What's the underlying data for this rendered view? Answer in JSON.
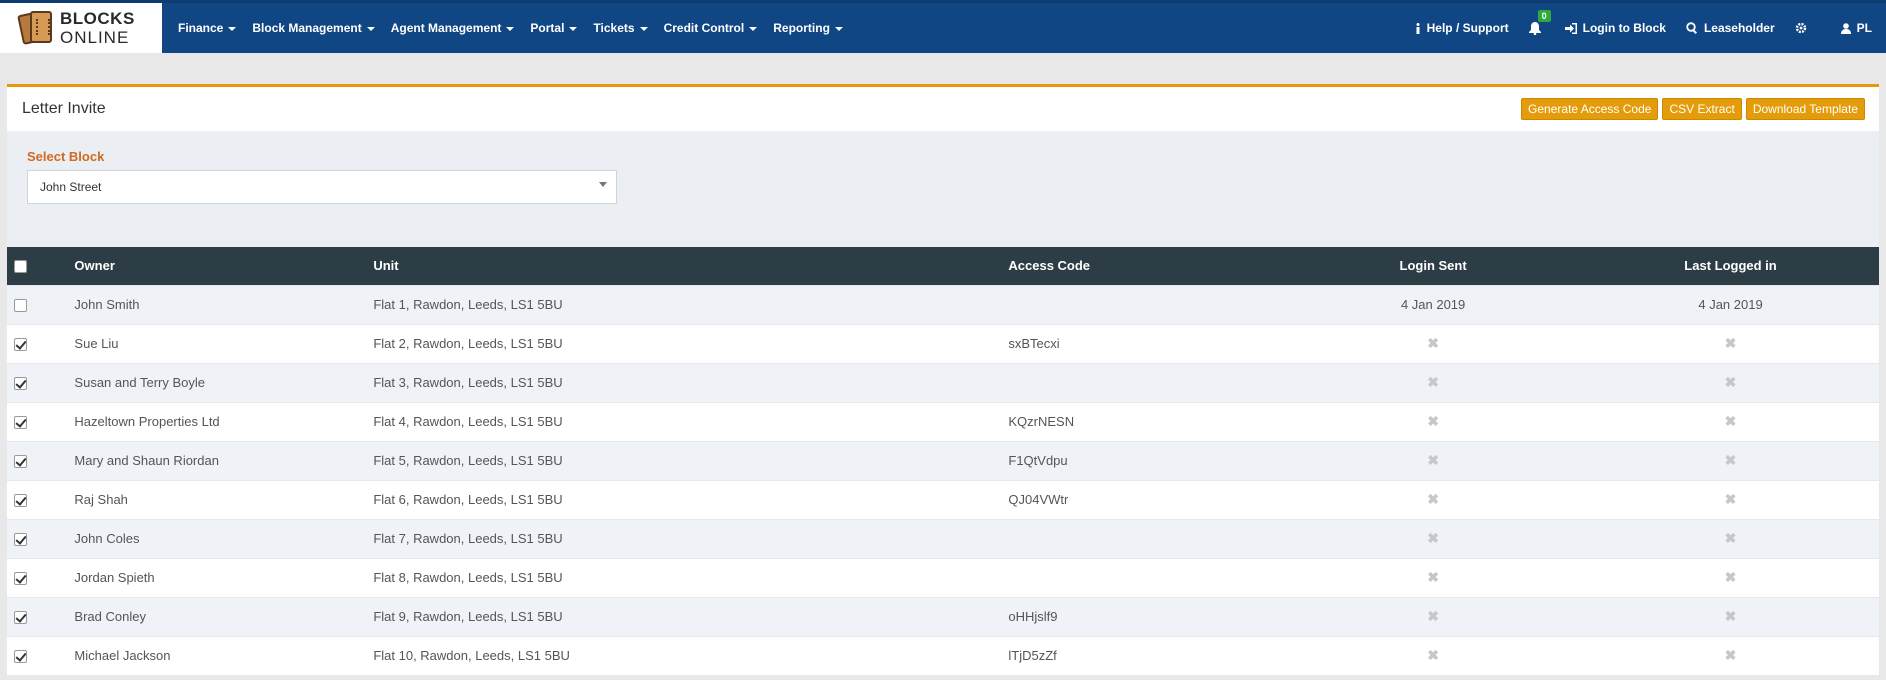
{
  "brand": {
    "line1": "BLOCKS",
    "line2": "ONLINE"
  },
  "nav": {
    "menu": [
      {
        "label": "Finance"
      },
      {
        "label": "Block Management"
      },
      {
        "label": "Agent Management"
      },
      {
        "label": "Portal"
      },
      {
        "label": "Tickets"
      },
      {
        "label": "Credit Control"
      },
      {
        "label": "Reporting"
      }
    ],
    "help": "Help / Support",
    "notifications_count": "0",
    "login_to_block": "Login to Block",
    "leaseholder": "Leaseholder",
    "user_initials": "PL"
  },
  "panel": {
    "title": "Letter Invite",
    "buttons": {
      "generate": "Generate Access Code",
      "csv": "CSV Extract",
      "download": "Download Template"
    },
    "select_block_label": "Select Block",
    "select_block_value": "John Street"
  },
  "table": {
    "headers": {
      "owner": "Owner",
      "unit": "Unit",
      "access_code": "Access Code",
      "login_sent": "Login Sent",
      "last_logged_in": "Last Logged in"
    },
    "rows": [
      {
        "checked": false,
        "owner": "John Smith",
        "unit": "Flat 1, Rawdon, Leeds, LS1 5BU",
        "access_code": "",
        "login_sent": "4 Jan 2019",
        "last_logged_in": "4 Jan 2019"
      },
      {
        "checked": true,
        "owner": "Sue Liu",
        "unit": "Flat 2, Rawdon, Leeds, LS1 5BU",
        "access_code": "sxBTecxi",
        "login_sent": "✖",
        "last_logged_in": "✖"
      },
      {
        "checked": true,
        "owner": "Susan and Terry Boyle",
        "unit": "Flat 3, Rawdon, Leeds, LS1 5BU",
        "access_code": "",
        "login_sent": "✖",
        "last_logged_in": "✖"
      },
      {
        "checked": true,
        "owner": "Hazeltown Properties Ltd",
        "unit": "Flat 4, Rawdon, Leeds, LS1 5BU",
        "access_code": "KQzrNESN",
        "login_sent": "✖",
        "last_logged_in": "✖"
      },
      {
        "checked": true,
        "owner": "Mary and Shaun Riordan",
        "unit": "Flat 5, Rawdon, Leeds, LS1 5BU",
        "access_code": "F1QtVdpu",
        "login_sent": "✖",
        "last_logged_in": "✖"
      },
      {
        "checked": true,
        "owner": "Raj Shah",
        "unit": "Flat 6, Rawdon, Leeds, LS1 5BU",
        "access_code": "QJ04VWtr",
        "login_sent": "✖",
        "last_logged_in": "✖"
      },
      {
        "checked": true,
        "owner": "John Coles",
        "unit": "Flat 7, Rawdon, Leeds, LS1 5BU",
        "access_code": "",
        "login_sent": "✖",
        "last_logged_in": "✖"
      },
      {
        "checked": true,
        "owner": "Jordan Spieth",
        "unit": "Flat 8, Rawdon, Leeds, LS1 5BU",
        "access_code": "",
        "login_sent": "✖",
        "last_logged_in": "✖"
      },
      {
        "checked": true,
        "owner": "Brad Conley",
        "unit": "Flat 9, Rawdon, Leeds, LS1 5BU",
        "access_code": "oHHjslf9",
        "login_sent": "✖",
        "last_logged_in": "✖"
      },
      {
        "checked": true,
        "owner": "Michael Jackson",
        "unit": "Flat 10, Rawdon, Leeds, LS1 5BU",
        "access_code": "lTjD5zZf",
        "login_sent": "✖",
        "last_logged_in": "✖"
      }
    ]
  }
}
